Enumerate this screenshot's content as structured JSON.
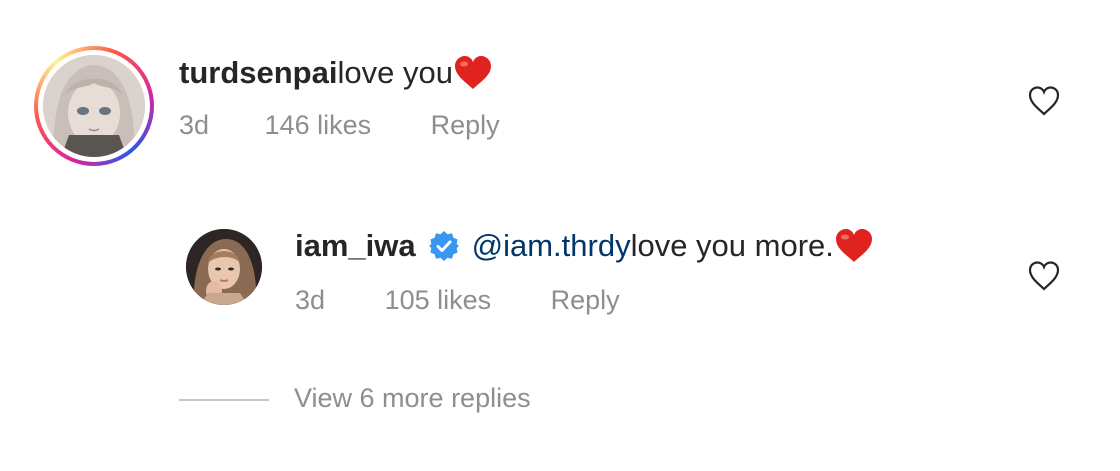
{
  "comment": {
    "username": "turdsenpai",
    "text": " love you",
    "emoji": "red-heart",
    "age": "3d",
    "likes": "146 likes",
    "reply_label": "Reply",
    "avatar_icon": "anime-girl-avatar",
    "like_icon": "heart-outline-icon"
  },
  "reply": {
    "username": "iam_iwa",
    "verified": true,
    "mention": "@iam.thrdy",
    "text": " love you more. ",
    "emoji": "red-heart",
    "age": "3d",
    "likes": "105 likes",
    "reply_label": "Reply",
    "avatar_icon": "selfie-avatar",
    "like_icon": "heart-outline-icon"
  },
  "view_more_label": "View 6 more replies",
  "colors": {
    "text": "#262626",
    "meta": "#8e8e8e",
    "mention": "#00376b",
    "verified": "#3897f0",
    "heart": "#e0231f"
  }
}
